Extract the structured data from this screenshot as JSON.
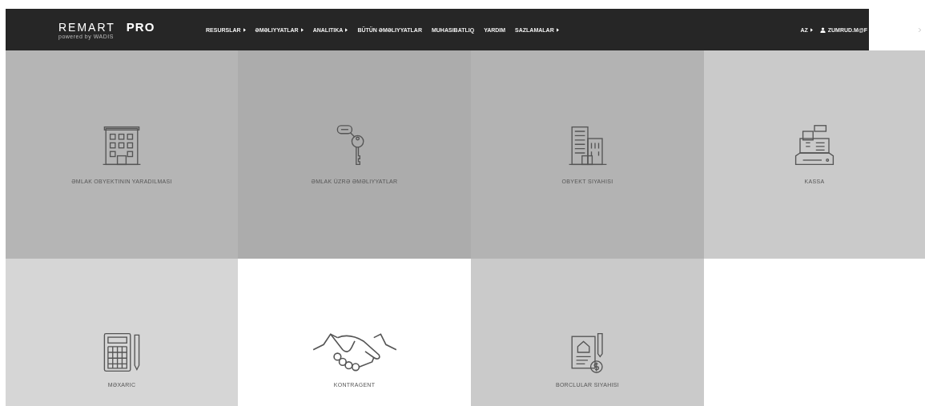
{
  "header": {
    "logo": "REMART",
    "logo_pro": "PRO",
    "tagline": "powered by WADIS",
    "menu": [
      {
        "label": "RESURSLAR",
        "dropdown": true
      },
      {
        "label": "ƏMƏLIYYATLAR",
        "dropdown": true
      },
      {
        "label": "ANALITIKA",
        "dropdown": true
      },
      {
        "label": "BÜTÜN ƏMƏLIYYATLAR",
        "dropdown": false
      },
      {
        "label": "MUHASIBATLIQ",
        "dropdown": false
      },
      {
        "label": "YARDIM",
        "dropdown": false
      },
      {
        "label": "SAZLAMALAR",
        "dropdown": true
      }
    ],
    "language": "AZ",
    "user": "ZUMRUD.M@F"
  },
  "tiles": [
    {
      "label": "ƏMLAK OBYEKTININ YARADILMASI",
      "kind": "building",
      "color": "#b5b5b5"
    },
    {
      "label": "ƏMLAK ÜZRƏ ƏMƏLIYYATLAR",
      "kind": "key",
      "color": "#acacac"
    },
    {
      "label": "OBYEKT SIYAHISI",
      "kind": "towers",
      "color": "#b3b3b3"
    },
    {
      "label": "KASSA",
      "kind": "register",
      "color": "#cacaca"
    },
    {
      "label": "MƏXARIC",
      "kind": "calculator",
      "color": "#d6d6d6"
    },
    {
      "label": "KONTRAGENT",
      "kind": "handshake",
      "color": "#ffffff"
    },
    {
      "label": "BORCLULAR SIYAHISI",
      "kind": "debt",
      "color": "#cacaca"
    }
  ]
}
